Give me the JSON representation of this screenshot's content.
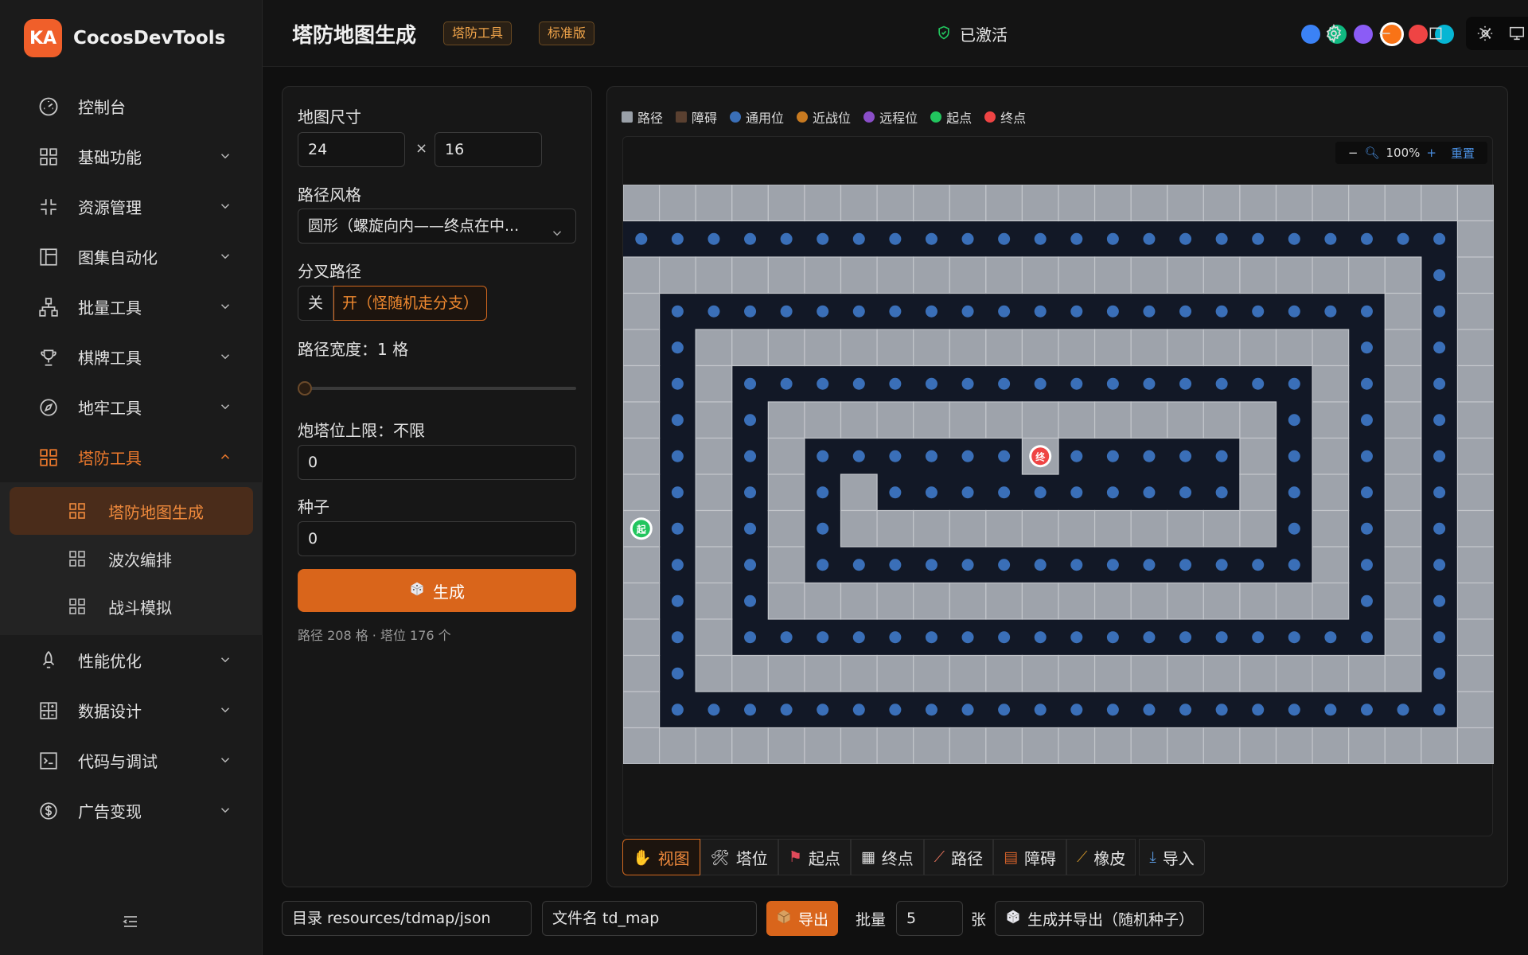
{
  "app": {
    "logo_text": "KA",
    "name": "CocosDevTools"
  },
  "sidebar": {
    "items": [
      {
        "label": "控制台",
        "icon": "gauge-icon"
      },
      {
        "label": "基础功能",
        "icon": "grid-icon"
      },
      {
        "label": "资源管理",
        "icon": "expand-icon"
      },
      {
        "label": "图集自动化",
        "icon": "layout-icon"
      },
      {
        "label": "批量工具",
        "icon": "hierarchy-icon"
      },
      {
        "label": "棋牌工具",
        "icon": "trophy-icon"
      },
      {
        "label": "地牢工具",
        "icon": "compass-icon"
      },
      {
        "label": "塔防工具",
        "icon": "grid-icon"
      },
      {
        "label": "性能优化",
        "icon": "rocket-icon"
      },
      {
        "label": "数据设计",
        "icon": "calculator-icon"
      },
      {
        "label": "代码与调试",
        "icon": "terminal-icon"
      },
      {
        "label": "广告变现",
        "icon": "dollar-icon"
      }
    ],
    "sub_items": [
      {
        "label": "塔防地图生成"
      },
      {
        "label": "波次编排"
      },
      {
        "label": "战斗模拟"
      }
    ]
  },
  "header": {
    "title": "塔防地图生成",
    "tag1": "塔防工具",
    "tag2": "标准版",
    "activated": "已激活",
    "swatches": [
      "#3b82f6",
      "#10b981",
      "#8b5cf6",
      "#f97316",
      "#ef4444",
      "#06b6d4"
    ],
    "selected_swatch": 3
  },
  "panel": {
    "map_size_label": "地图尺寸",
    "width": "24",
    "times": "×",
    "height": "16",
    "path_style_label": "路径风格",
    "path_style_value": "圆形（螺旋向内——终点在中...",
    "branch_label": "分叉路径",
    "branch_off": "关",
    "branch_on": "开（怪随机走分支）",
    "width_label": "路径宽度：1 格",
    "path_width": 1,
    "tower_limit_label": "炮塔位上限：不限",
    "tower_limit_value": "0",
    "seed_label": "种子",
    "seed_value": "0",
    "generate_label": "生成",
    "stats": "路径 208 格 · 塔位 176 个"
  },
  "legend": [
    {
      "label": "路径",
      "color": "#9aa0a8",
      "shape": "square"
    },
    {
      "label": "障碍",
      "color": "#5a4030",
      "shape": "square"
    },
    {
      "label": "通用位",
      "color": "#3a6fb8",
      "shape": "circle"
    },
    {
      "label": "近战位",
      "color": "#c87a20",
      "shape": "circle"
    },
    {
      "label": "远程位",
      "color": "#8a4ec8",
      "shape": "circle"
    },
    {
      "label": "起点",
      "color": "#22c55e",
      "shape": "circle"
    },
    {
      "label": "终点",
      "color": "#ef4444",
      "shape": "circle"
    }
  ],
  "zoom": {
    "minus": "−",
    "level": "100%",
    "plus": "+",
    "reset": "重置"
  },
  "map": {
    "cols": 24,
    "rows": 16,
    "start_label": "起",
    "end_label": "终",
    "colors": {
      "path": "#9ea3ab",
      "grid_line": "#c3c6cb",
      "bg": "#121826",
      "tower": "#3a6fb8"
    }
  },
  "toolbar": [
    {
      "label": "视图",
      "icon": "✋"
    },
    {
      "label": "塔位",
      "icon": "🛠"
    },
    {
      "label": "起点",
      "icon": "⚑"
    },
    {
      "label": "终点",
      "icon": "▦"
    },
    {
      "label": "路径",
      "icon": "⟋"
    },
    {
      "label": "障碍",
      "icon": "▤"
    },
    {
      "label": "橡皮",
      "icon": "⟋"
    },
    {
      "label": "导入",
      "icon": "⤓"
    }
  ],
  "footer": {
    "dir": "目录 resources/tdmap/json",
    "filename": "文件名 td_map",
    "export_label": "导出",
    "batch_label": "批量",
    "batch_value": "5",
    "batch_unit": "张",
    "gen_export_label": "生成并导出（随机种子）"
  }
}
